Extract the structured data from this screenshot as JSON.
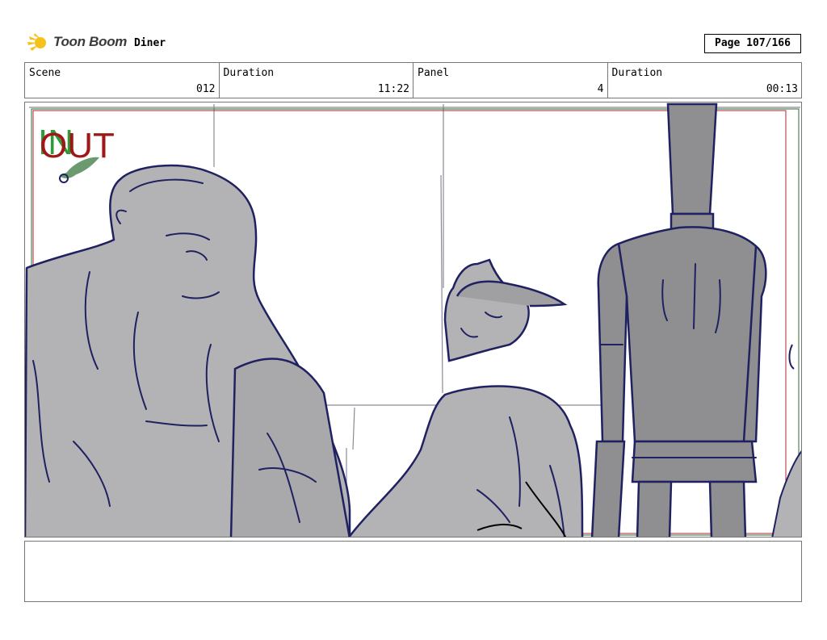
{
  "header": {
    "logo_text": "Toon Boom",
    "project_title": "Diner",
    "page_label": "Page 107/166"
  },
  "info": [
    {
      "label": "Scene",
      "value": "012"
    },
    {
      "label": "Duration",
      "value": "11:22"
    },
    {
      "label": "Panel",
      "value": "4"
    },
    {
      "label": "Duration",
      "value": "00:13"
    }
  ],
  "panel": {
    "in_label": "IN",
    "out_label": "OUT",
    "colors": {
      "in_marker": "#2e9b3a",
      "out_marker": "#a01717",
      "ink": "#1f2160",
      "fill_light": "#b3b3b5",
      "fill_dark": "#8f8f91"
    }
  },
  "caption": {
    "text": ""
  }
}
